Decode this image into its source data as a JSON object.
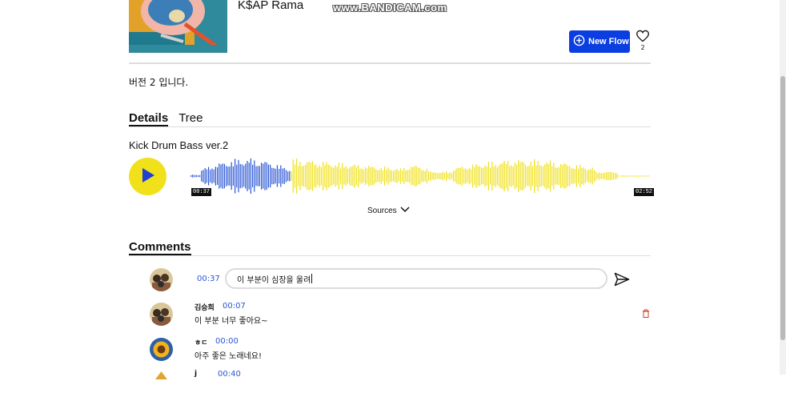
{
  "header": {
    "artist": "K$AP Rama",
    "watermark": "www.BANDICAM.com",
    "new_flow_label": "New Flow",
    "like_count": "2"
  },
  "description": "버전 2 입니다.",
  "tabs": [
    {
      "label": "Details",
      "active": true
    },
    {
      "label": "Tree",
      "active": false
    }
  ],
  "player": {
    "track_title": "Kick Drum Bass ver.2",
    "current_time": "00:37",
    "total_time": "02:52",
    "progress": 0.215,
    "played_color": "#2b57d6",
    "unplayed_color": "#f0e11b",
    "sources_label": "Sources"
  },
  "comments": {
    "heading": "Comments",
    "input": {
      "timestamp": "00:37",
      "value": "이 부분이 심장을 울려"
    },
    "items": [
      {
        "author": "김승희",
        "timestamp": "00:07",
        "text": "이 부분 너무 좋아요~"
      },
      {
        "author": "ㅎㄷ",
        "timestamp": "00:00",
        "text": "아주 좋은 노래네요!"
      },
      {
        "author": "j",
        "timestamp": "00:40",
        "text": ""
      }
    ]
  }
}
